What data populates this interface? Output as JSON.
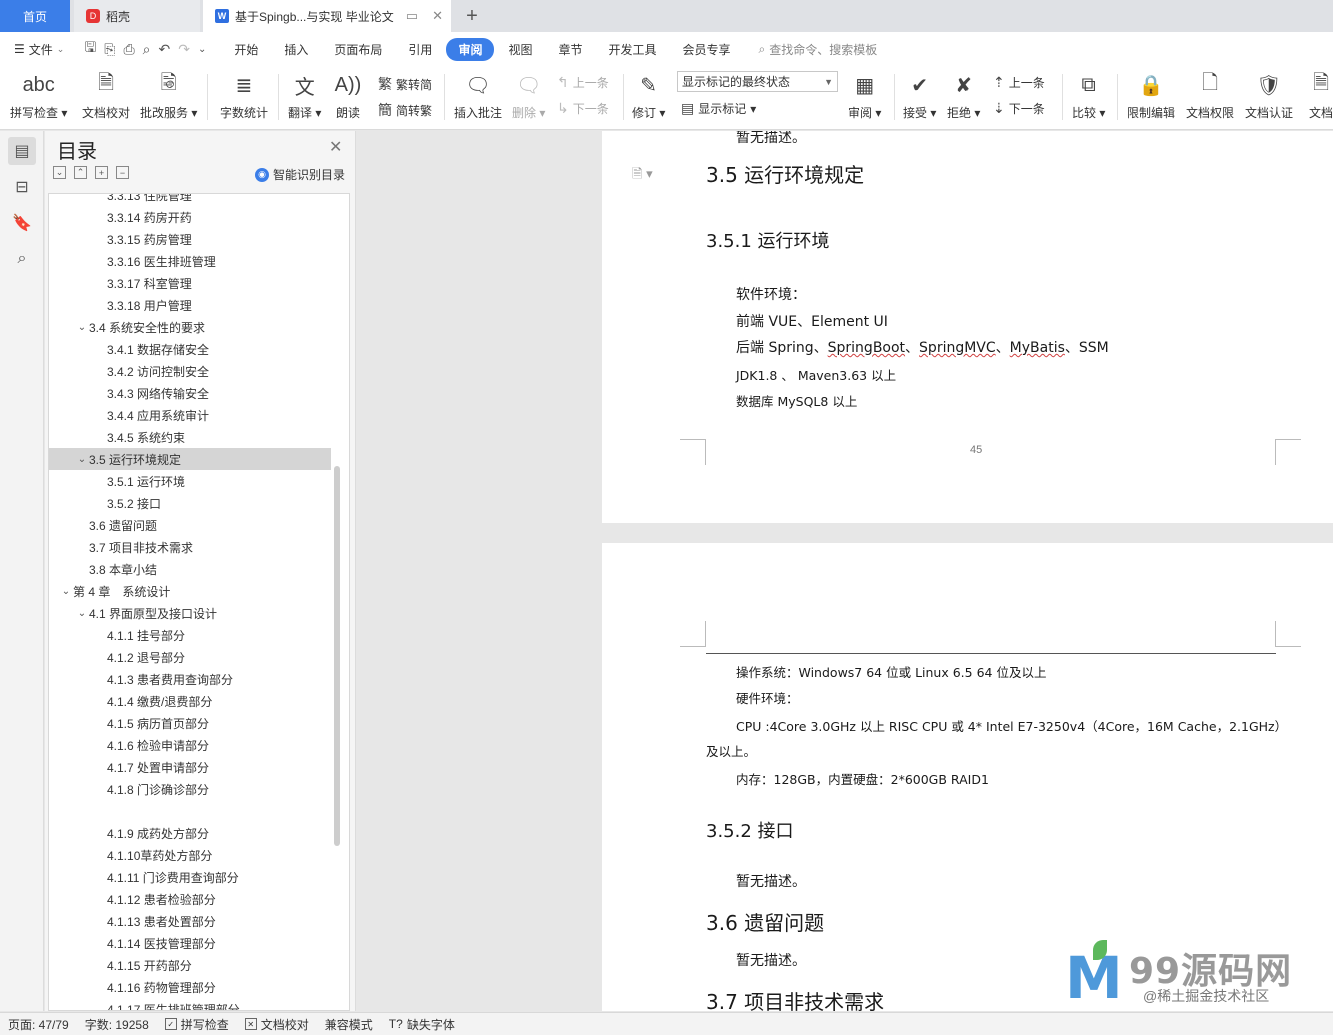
{
  "tabs": {
    "home": "首页",
    "daoke": "稻壳",
    "doc": "基于Spingb...与实现 毕业论文",
    "doc_logo": "W",
    "daoke_logo": "D"
  },
  "menu": {
    "file": "文件",
    "tabs": [
      "开始",
      "插入",
      "页面布局",
      "引用",
      "审阅",
      "视图",
      "章节",
      "开发工具",
      "会员专享"
    ],
    "active_tab": "审阅",
    "search": "查找命令、搜索模板"
  },
  "ribbon": {
    "spell": "拼写检查",
    "proof": "文档校对",
    "annot_service": "批改服务",
    "wordcount": "字数统计",
    "translate": "翻译",
    "read_aloud": "朗读",
    "trad": "繁转简",
    "simp": "简转繁",
    "insert_comment": "插入批注",
    "delete": "删除",
    "prev_comment": "上一条",
    "next_comment": "下一条",
    "track": "修订",
    "markup_state": "显示标记的最终状态",
    "show_markup": "显示标记",
    "review": "审阅",
    "accept": "接受",
    "reject": "拒绝",
    "prev": "上一条",
    "next": "下一条",
    "compare": "比较",
    "restrict": "限制编辑",
    "permission": "文档权限",
    "certify": "文档认证",
    "more": "文档"
  },
  "toc": {
    "title": "目录",
    "smart": "智能识别目录",
    "items": [
      {
        "label": "3.3.13 住院管理",
        "level": 3
      },
      {
        "label": "3.3.14 药房开药",
        "level": 3
      },
      {
        "label": "3.3.15 药房管理",
        "level": 3
      },
      {
        "label": "3.3.16 医生排班管理",
        "level": 3
      },
      {
        "label": "3.3.17 科室管理",
        "level": 3
      },
      {
        "label": "3.3.18 用户管理",
        "level": 3
      },
      {
        "label": "3.4 系统安全性的要求",
        "level": 2,
        "expanded": true
      },
      {
        "label": "3.4.1 数据存储安全",
        "level": 3
      },
      {
        "label": "3.4.2 访问控制安全",
        "level": 3
      },
      {
        "label": "3.4.3 网络传输安全",
        "level": 3
      },
      {
        "label": "3.4.4 应用系统审计",
        "level": 3
      },
      {
        "label": "3.4.5 系统约束",
        "level": 3
      },
      {
        "label": "3.5 运行环境规定",
        "level": 2,
        "expanded": true,
        "selected": true
      },
      {
        "label": "3.5.1 运行环境",
        "level": 3
      },
      {
        "label": "3.5.2 接口",
        "level": 3
      },
      {
        "label": "3.6 遗留问题",
        "level": 2
      },
      {
        "label": "3.7 项目非技术需求",
        "level": 2
      },
      {
        "label": "3.8 本章小结",
        "level": 2
      },
      {
        "label": "第 4 章　系统设计",
        "level": 1,
        "expanded": true
      },
      {
        "label": "4.1  界面原型及接口设计",
        "level": 2,
        "expanded": true
      },
      {
        "label": "4.1.1  挂号部分",
        "level": 3
      },
      {
        "label": "4.1.2  退号部分",
        "level": 3
      },
      {
        "label": "4.1.3  患者费用查询部分",
        "level": 3
      },
      {
        "label": "4.1.4  缴费/退费部分",
        "level": 3
      },
      {
        "label": "4.1.5  病历首页部分",
        "level": 3
      },
      {
        "label": "4.1.6  检验申请部分",
        "level": 3
      },
      {
        "label": "4.1.7  处置申请部分",
        "level": 3
      },
      {
        "label": "4.1.8  门诊确诊部分",
        "level": 3
      },
      {
        "label": "",
        "level": 3
      },
      {
        "label": "4.1.9  成药处方部分",
        "level": 3
      },
      {
        "label": "4.1.10草药处方部分",
        "level": 3
      },
      {
        "label": "4.1.11 门诊费用查询部分",
        "level": 3
      },
      {
        "label": "4.1.12 患者检验部分",
        "level": 3
      },
      {
        "label": "4.1.13 患者处置部分",
        "level": 3
      },
      {
        "label": "4.1.14 医技管理部分",
        "level": 3
      },
      {
        "label": "4.1.15 开药部分",
        "level": 3
      },
      {
        "label": "4.1.16 药物管理部分",
        "level": 3
      },
      {
        "label": "4.1.17 医生排班管理部分",
        "level": 3
      }
    ]
  },
  "doc": {
    "page1": {
      "top_text": "暂无描述。",
      "h_35": "3.5 运行环境规定",
      "h_351": "3.5.1 运行环境",
      "soft_env": "软件环境：",
      "frontend": "前端 VUE、Element UI",
      "backend_prefix": "后端 Spring、",
      "backend_sb": "SpringBoot",
      "sep1": "、",
      "backend_mvc": "SpringMVC",
      "sep2": "、",
      "backend_mb": "MyBatis",
      "backend_suffix": "、SSM",
      "jdk": "JDK1.8 、 Maven3.63 以上",
      "db": "数据库 MySQL8 以上",
      "page_no": "45"
    },
    "page2": {
      "os": "操作系统：Windows7 64 位或 Linux 6.5 64 位及以上",
      "hw": "硬件环境：",
      "cpu": "CPU :4Core 3.0GHz  以上 RISC CPU 或 4* Intel E7-3250v4（4Core，16M Cache，2.1GHz）",
      "cpu2": "及以上。",
      "mem": "内存：128GB，内置硬盘：2*600GB RAID1",
      "h_352": "3.5.2 接口",
      "none1": "暂无描述。",
      "h_36": "3.6 遗留问题",
      "none2": "暂无描述。",
      "h_37": "3.7 项目非技术需求"
    }
  },
  "watermark": {
    "brand": "99源码网",
    "sub": "@稀土掘金技术社区"
  },
  "status": {
    "page": "页面: 47/79",
    "words": "字数: 19258",
    "spell": "拼写检查",
    "proof": "文档校对",
    "compat": "兼容模式",
    "missing_font": "缺失字体"
  }
}
